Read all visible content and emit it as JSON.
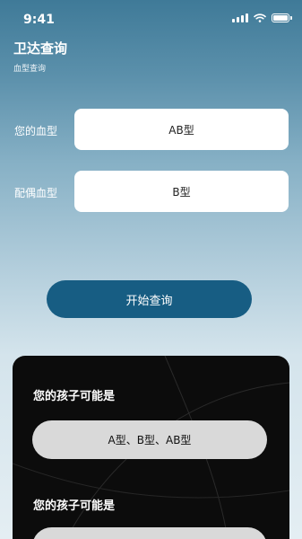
{
  "status_bar": {
    "time": "9:41"
  },
  "header": {
    "title": "卫达查询",
    "subtitle": "血型查询"
  },
  "form": {
    "your_blood_label": "您的血型",
    "your_blood_value": "AB型",
    "spouse_blood_label": "配偶血型",
    "spouse_blood_value": "B型"
  },
  "query_button_label": "开始查询",
  "results": [
    {
      "heading": "您的孩子可能是",
      "value": "A型、B型、AB型"
    },
    {
      "heading": "您的孩子可能是",
      "value": ""
    }
  ]
}
